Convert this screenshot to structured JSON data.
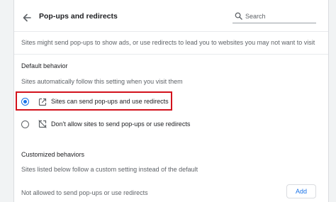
{
  "header": {
    "title": "Pop-ups and redirects",
    "search_placeholder": "Search"
  },
  "description": "Sites might send pop-ups to show ads, or use redirects to lead you to websites you may not want to visit",
  "default_behavior": {
    "heading": "Default behavior",
    "subtext": "Sites automatically follow this setting when you visit them",
    "options": [
      {
        "label": "Sites can send pop-ups and use redirects",
        "selected": true,
        "icon": "open-in-new-icon"
      },
      {
        "label": "Don't allow sites to send pop-ups or use redirects",
        "selected": false,
        "icon": "popup-blocked-icon"
      }
    ]
  },
  "customized_behaviors": {
    "heading": "Customized behaviors",
    "subtext": "Sites listed below follow a custom setting instead of the default",
    "not_allowed_label": "Not allowed to send pop-ups or use redirects",
    "add_label": "Add"
  },
  "colors": {
    "accent": "#1a73e8",
    "highlight": "#d3121c"
  }
}
